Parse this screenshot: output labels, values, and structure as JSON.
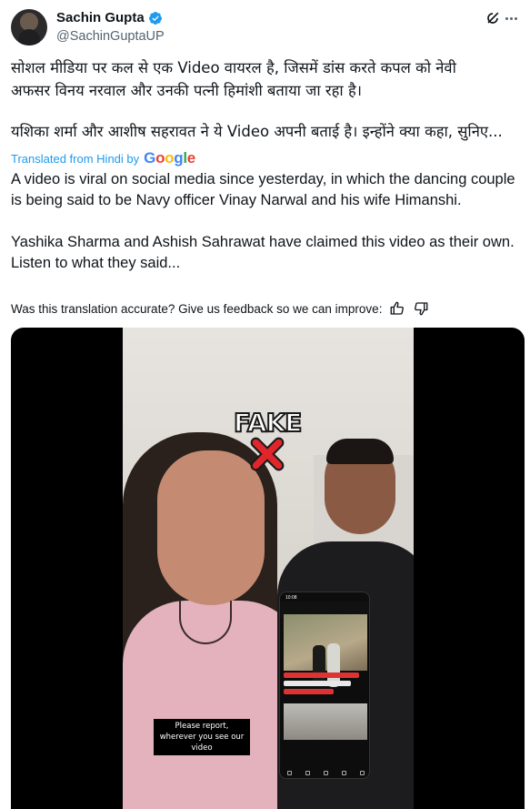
{
  "author": {
    "name": "Sachin Gupta",
    "handle": "@SachinGuptaUP",
    "verified": true
  },
  "tweet": {
    "hindi_line1": "सोशल मीडिया पर कल से एक Video वायरल है, जिसमें डांस करते कपल को नेवी",
    "hindi_line2": "अफसर विनय नरवाल और उनकी पत्नी हिमांशी बताया जा रहा है।",
    "hindi_line3": "यशिका शर्मा और आशीष सहरावत ने ये Video अपनी बताई है। इन्होंने क्या कहा, सुनिए..."
  },
  "translation": {
    "label": "Translated from Hindi by",
    "provider": "Google",
    "paragraph1": "A video is viral on social media since yesterday, in which the dancing couple is being said to be Navy officer Vinay Narwal and his wife Himanshi.",
    "paragraph2": "Yashika Sharma and Ashish Sahrawat have claimed this video as their own. Listen to what they said...",
    "feedback_prompt": "Was this translation accurate? Give us feedback so we can improve:"
  },
  "video": {
    "overlay_label": "FAKE",
    "subtitle": "Please report, wherever you see our video",
    "phone_time": "10:08"
  },
  "colors": {
    "link_blue": "#1d9bf0",
    "verified_blue": "#1d9bf0",
    "muted_text": "#536471",
    "fake_x_red": "#e0262b"
  },
  "icons": {
    "grok": "grok-icon",
    "more": "more-dots-icon",
    "thumbs_up": "thumbs-up-icon",
    "thumbs_down": "thumbs-down-icon",
    "verified": "verified-badge-icon"
  }
}
